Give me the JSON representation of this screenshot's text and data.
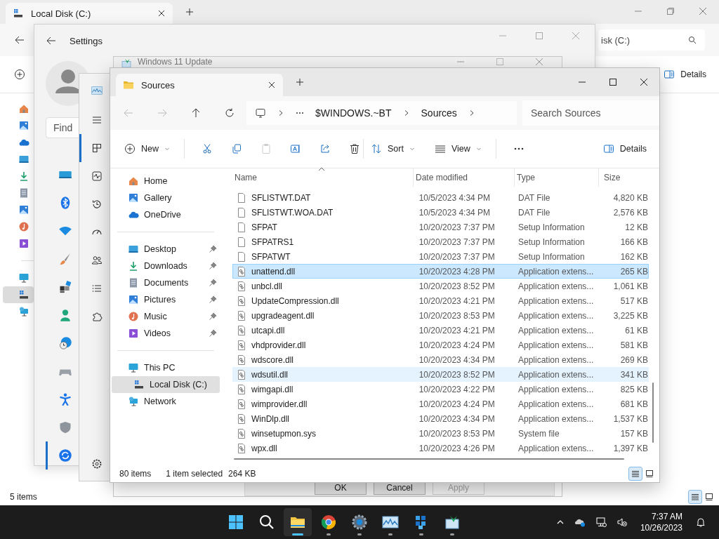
{
  "desktop_explorer": {
    "tab": "Local Disk (C:)",
    "address": "isk (C:)",
    "details_button": "Details",
    "status": "5 items",
    "view_buttons": [
      {
        "kind": "details",
        "selected": true
      },
      {
        "kind": "tiles",
        "selected": false
      }
    ],
    "nav": [
      {
        "kind": "home",
        "selected": false
      },
      {
        "kind": "gallery",
        "selected": false
      },
      {
        "kind": "onedrive",
        "selected": false
      },
      {
        "kind": "desktop",
        "selected": false
      },
      {
        "kind": "downloads",
        "selected": false
      },
      {
        "kind": "documents",
        "selected": false
      },
      {
        "kind": "pictures",
        "selected": false
      },
      {
        "kind": "music",
        "selected": false
      },
      {
        "kind": "videos",
        "selected": false
      },
      {
        "kind": "pc",
        "selected": false
      },
      {
        "kind": "disk",
        "selected": true
      },
      {
        "kind": "network",
        "selected": false
      }
    ]
  },
  "settings": {
    "title": "Settings",
    "search": {
      "placeholder": "Find"
    },
    "nav": [
      {
        "kind": "system",
        "selected": false
      },
      {
        "kind": "bluetooth",
        "selected": false
      },
      {
        "kind": "wifi",
        "selected": false
      },
      {
        "kind": "brush",
        "selected": false
      },
      {
        "kind": "apps",
        "selected": false
      },
      {
        "kind": "account",
        "selected": false
      },
      {
        "kind": "time",
        "selected": false
      },
      {
        "kind": "gaming",
        "selected": false
      },
      {
        "kind": "accessibility",
        "selected": false
      },
      {
        "kind": "privacy",
        "selected": false
      },
      {
        "kind": "update",
        "selected": true
      }
    ]
  },
  "update_window": {
    "title": "Windows 11 Update",
    "buttons": [
      {
        "label": "OK",
        "disabled": false
      },
      {
        "label": "Cancel",
        "disabled": false
      },
      {
        "label": "Apply",
        "disabled": true
      }
    ]
  },
  "task_manager": {
    "nav": [
      {
        "kind": "menu",
        "selected": false
      },
      {
        "kind": "processes",
        "selected": true
      },
      {
        "kind": "performance",
        "selected": false
      },
      {
        "kind": "history",
        "selected": false
      },
      {
        "kind": "startup",
        "selected": false
      },
      {
        "kind": "users",
        "selected": false
      },
      {
        "kind": "details",
        "selected": false
      },
      {
        "kind": "services",
        "selected": false
      }
    ]
  },
  "explorer": {
    "tab": "Sources",
    "breadcrumbs": [
      "$WINDOWS.~BT",
      "Sources"
    ],
    "search": {
      "placeholder": "Search Sources"
    },
    "toolbar": {
      "new": "New",
      "sort": "Sort",
      "view": "View",
      "details": "Details"
    },
    "nav": [
      [
        {
          "label": "Home",
          "kind": "home",
          "pinned": false,
          "selected": false
        },
        {
          "label": "Gallery",
          "kind": "gallery",
          "pinned": false,
          "selected": false
        },
        {
          "label": "OneDrive",
          "kind": "onedrive",
          "pinned": false,
          "selected": false
        }
      ],
      [
        {
          "label": "Desktop",
          "kind": "desktop",
          "pinned": true,
          "selected": false
        },
        {
          "label": "Downloads",
          "kind": "downloads",
          "pinned": true,
          "selected": false
        },
        {
          "label": "Documents",
          "kind": "documents",
          "pinned": true,
          "selected": false
        },
        {
          "label": "Pictures",
          "kind": "pictures",
          "pinned": true,
          "selected": false
        },
        {
          "label": "Music",
          "kind": "music",
          "pinned": true,
          "selected": false
        },
        {
          "label": "Videos",
          "kind": "videos",
          "pinned": true,
          "selected": false
        }
      ],
      [
        {
          "label": "This PC",
          "kind": "pc",
          "pinned": false,
          "selected": false,
          "children": [
            {
              "label": "Local Disk (C:)",
              "kind": "disk",
              "pinned": false,
              "selected": true
            }
          ]
        },
        {
          "label": "Network",
          "kind": "network",
          "pinned": false,
          "selected": false
        }
      ]
    ],
    "columns": [
      "Name",
      "Date modified",
      "Type",
      "Size"
    ],
    "rows": [
      {
        "name": "SFLISTWT.DAT",
        "date": "10/5/2023 4:34 PM",
        "type": "DAT File",
        "size": "4,820 KB",
        "kind": "document",
        "selected": false,
        "hovered": false
      },
      {
        "name": "SFLISTWT.WOA.DAT",
        "date": "10/5/2023 4:34 PM",
        "type": "DAT File",
        "size": "2,576 KB",
        "kind": "document",
        "selected": false,
        "hovered": false
      },
      {
        "name": "SFPAT",
        "date": "10/20/2023 7:37 PM",
        "type": "Setup Information",
        "size": "12 KB",
        "kind": "document",
        "selected": false,
        "hovered": false
      },
      {
        "name": "SFPATRS1",
        "date": "10/20/2023 7:37 PM",
        "type": "Setup Information",
        "size": "166 KB",
        "kind": "document",
        "selected": false,
        "hovered": false
      },
      {
        "name": "SFPATWT",
        "date": "10/20/2023 7:37 PM",
        "type": "Setup Information",
        "size": "162 KB",
        "kind": "document",
        "selected": false,
        "hovered": false
      },
      {
        "name": "unattend.dll",
        "date": "10/20/2023 4:28 PM",
        "type": "Application extens...",
        "size": "265 KB",
        "kind": "extension",
        "selected": true,
        "hovered": false
      },
      {
        "name": "unbcl.dll",
        "date": "10/20/2023 8:52 PM",
        "type": "Application extens...",
        "size": "1,061 KB",
        "kind": "extension",
        "selected": false,
        "hovered": false
      },
      {
        "name": "UpdateCompression.dll",
        "date": "10/20/2023 4:21 PM",
        "type": "Application extens...",
        "size": "517 KB",
        "kind": "extension",
        "selected": false,
        "hovered": false
      },
      {
        "name": "upgradeagent.dll",
        "date": "10/20/2023 8:53 PM",
        "type": "Application extens...",
        "size": "3,225 KB",
        "kind": "extension",
        "selected": false,
        "hovered": false
      },
      {
        "name": "utcapi.dll",
        "date": "10/20/2023 4:21 PM",
        "type": "Application extens...",
        "size": "61 KB",
        "kind": "extension",
        "selected": false,
        "hovered": false
      },
      {
        "name": "vhdprovider.dll",
        "date": "10/20/2023 4:24 PM",
        "type": "Application extens...",
        "size": "581 KB",
        "kind": "extension",
        "selected": false,
        "hovered": false
      },
      {
        "name": "wdscore.dll",
        "date": "10/20/2023 4:34 PM",
        "type": "Application extens...",
        "size": "269 KB",
        "kind": "extension",
        "selected": false,
        "hovered": false
      },
      {
        "name": "wdsutil.dll",
        "date": "10/20/2023 8:52 PM",
        "type": "Application extens...",
        "size": "341 KB",
        "kind": "extension",
        "selected": false,
        "hovered": true
      },
      {
        "name": "wimgapi.dll",
        "date": "10/20/2023 4:22 PM",
        "type": "Application extens...",
        "size": "825 KB",
        "kind": "extension",
        "selected": false,
        "hovered": false
      },
      {
        "name": "wimprovider.dll",
        "date": "10/20/2023 4:24 PM",
        "type": "Application extens...",
        "size": "681 KB",
        "kind": "extension",
        "selected": false,
        "hovered": false
      },
      {
        "name": "WinDlp.dll",
        "date": "10/20/2023 4:34 PM",
        "type": "Application extens...",
        "size": "1,537 KB",
        "kind": "extension",
        "selected": false,
        "hovered": false
      },
      {
        "name": "winsetupmon.sys",
        "date": "10/20/2023 8:53 PM",
        "type": "System file",
        "size": "157 KB",
        "kind": "extension",
        "selected": false,
        "hovered": false
      },
      {
        "name": "wpx.dll",
        "date": "10/20/2023 4:26 PM",
        "type": "Application extens...",
        "size": "1,397 KB",
        "kind": "extension",
        "selected": false,
        "hovered": false
      }
    ],
    "status": {
      "count": "80 items",
      "selection": "1 item selected",
      "size": "264 KB"
    },
    "view_buttons": [
      {
        "kind": "details",
        "selected": true
      },
      {
        "kind": "tiles",
        "selected": false
      }
    ]
  },
  "taskbar": {
    "apps": [
      {
        "kind": "start",
        "running": false,
        "active": false
      },
      {
        "kind": "search",
        "running": false,
        "active": false
      },
      {
        "kind": "explorer",
        "running": true,
        "active": true
      },
      {
        "kind": "chrome",
        "running": true,
        "active": false
      },
      {
        "kind": "settings",
        "running": true,
        "active": false
      },
      {
        "kind": "taskmgr",
        "running": true,
        "active": false
      },
      {
        "kind": "cubes",
        "running": true,
        "active": false
      },
      {
        "kind": "installer",
        "running": true,
        "active": false
      }
    ],
    "time": "7:37 AM",
    "date": "10/26/2023"
  }
}
